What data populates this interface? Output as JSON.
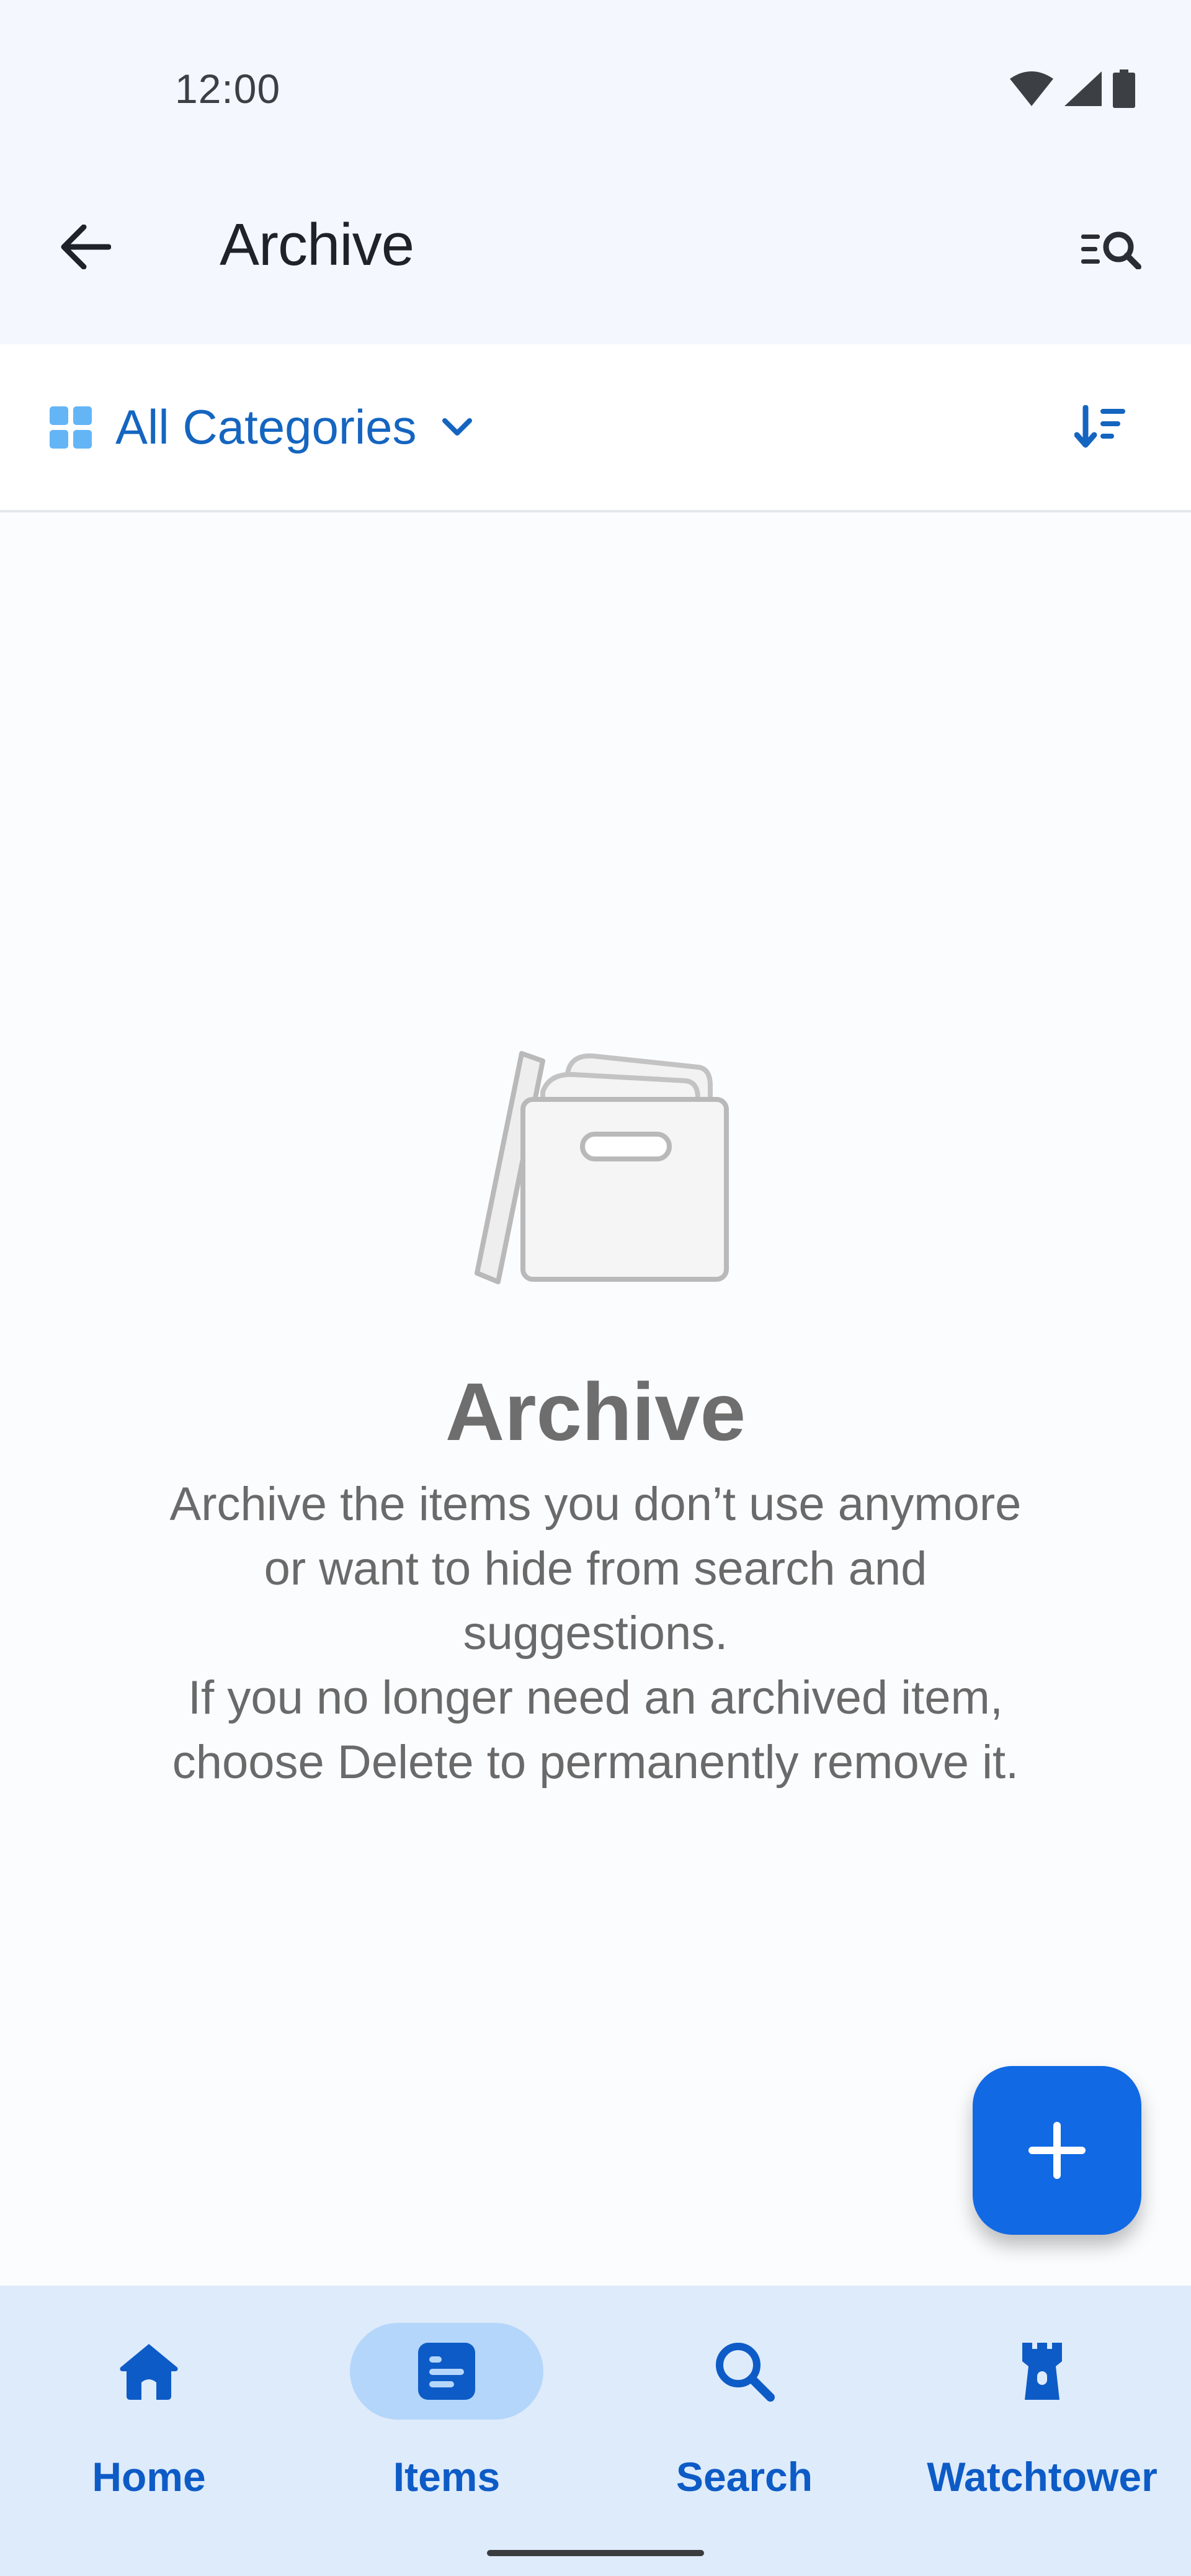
{
  "status_bar": {
    "time": "12:00",
    "icons": [
      "wifi-icon",
      "signal-icon",
      "battery-icon"
    ]
  },
  "app_bar": {
    "title": "Archive",
    "back_icon": "arrow-left-icon",
    "action_icon": "list-search-icon"
  },
  "filter_bar": {
    "category_label": "All Categories",
    "category_icon": "grid-icon",
    "dropdown_icon": "chevron-down-icon",
    "sort_icon": "sort-icon"
  },
  "empty_state": {
    "illustration": "archive-box-icon",
    "title": "Archive",
    "description_lines": [
      "Archive the items you don’t use anymore",
      "or want to hide from search and",
      "suggestions.",
      "If you no longer need an archived item,",
      "choose Delete to permanently remove it."
    ]
  },
  "fab": {
    "icon": "plus-icon"
  },
  "bottom_nav": {
    "items": [
      {
        "label": "Home",
        "icon": "home-icon",
        "active": false
      },
      {
        "label": "Items",
        "icon": "items-icon",
        "active": true
      },
      {
        "label": "Search",
        "icon": "search-icon",
        "active": false
      },
      {
        "label": "Watchtower",
        "icon": "watchtower-icon",
        "active": false
      }
    ]
  },
  "colors": {
    "accent": "#1169e4",
    "nav_background": "#deebfb",
    "nav_active_pill": "#b5d6fb",
    "nav_label": "#0d5bc6",
    "category_text": "#1565c0"
  }
}
